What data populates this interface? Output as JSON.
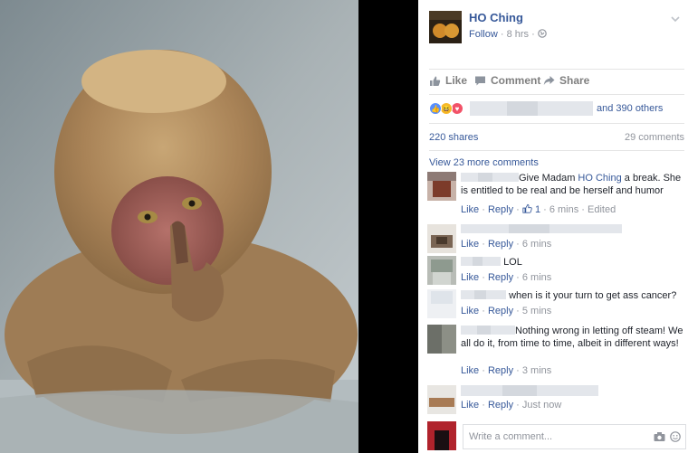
{
  "post": {
    "page_name": "HO Ching",
    "follow_label": "Follow",
    "time": "8 hrs",
    "actions": {
      "like": "Like",
      "comment": "Comment",
      "share": "Share"
    },
    "reactions_text": "and 390 others",
    "shares": "220 shares",
    "comments_count": "29 comments",
    "view_more": "View 23 more comments",
    "write_placeholder": "Write a comment..."
  },
  "comments": [
    {
      "text_before": "Give Madam ",
      "mention": "HO Ching",
      "text_after": " a break. She is entitled to be real and be herself and humor",
      "like": "Like",
      "reply": "Reply",
      "like_count": "1",
      "time": "6 mins",
      "edited": "Edited"
    },
    {
      "text": "",
      "like": "Like",
      "reply": "Reply",
      "time": "6 mins"
    },
    {
      "text": "LOL",
      "like": "Like",
      "reply": "Reply",
      "time": "6 mins"
    },
    {
      "text": "when is it your turn to get ass cancer?",
      "like": "Like",
      "reply": "Reply",
      "time": "5 mins"
    },
    {
      "text": "Nothing wrong in letting off steam! We all do it, from time to time, albeit in different ways!",
      "like": "Like",
      "reply": "Reply",
      "time": "3 mins"
    },
    {
      "text": "",
      "like": "Like",
      "reply": "Reply",
      "time": "Just now"
    }
  ],
  "colors": {
    "link": "#365899",
    "meta": "#90949c",
    "like_reaction": "#5890ff",
    "haha_reaction": "#f7b928",
    "love_reaction": "#f25268"
  }
}
